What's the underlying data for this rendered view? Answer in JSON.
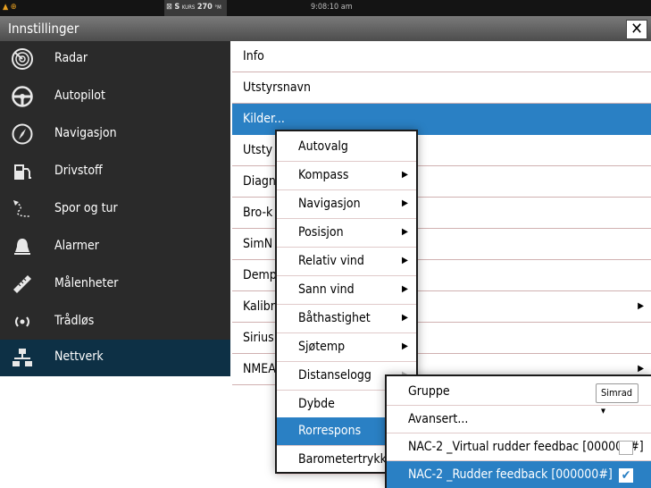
{
  "status_bar": {
    "kurs_prefix": "S",
    "kurs_label": "KURS",
    "kurs_value": "270",
    "kurs_unit": "°M",
    "time": "9:08:10 am"
  },
  "titlebar": {
    "title": "Innstillinger",
    "close_symbol": "✕"
  },
  "sidebar": {
    "items": [
      {
        "label": "Radar",
        "icon": "radar-icon"
      },
      {
        "label": "Autopilot",
        "icon": "steering-wheel-icon"
      },
      {
        "label": "Navigasjon",
        "icon": "compass-icon"
      },
      {
        "label": "Drivstoff",
        "icon": "fuel-pump-icon"
      },
      {
        "label": "Spor og tur",
        "icon": "track-icon"
      },
      {
        "label": "Alarmer",
        "icon": "bell-icon"
      },
      {
        "label": "Målenheter",
        "icon": "ruler-icon"
      },
      {
        "label": "Trådløs",
        "icon": "wireless-icon"
      },
      {
        "label": "Nettverk",
        "icon": "network-icon"
      }
    ],
    "selected_index": 8
  },
  "content": {
    "rows": [
      {
        "label": "Info"
      },
      {
        "label": "Utstyrsnavn"
      },
      {
        "label": "Kilder..."
      },
      {
        "label": "Utsty"
      },
      {
        "label": "Diagn"
      },
      {
        "label": "Bro-k"
      },
      {
        "label": "SimN"
      },
      {
        "label": "Demp"
      },
      {
        "label": "Kalibr"
      },
      {
        "label": "Sirius"
      },
      {
        "label": "NMEA"
      }
    ],
    "selected_index": 2
  },
  "menu": {
    "items": [
      {
        "label": "Autovalg"
      },
      {
        "label": "Kompass"
      },
      {
        "label": "Navigasjon"
      },
      {
        "label": "Posisjon"
      },
      {
        "label": "Relativ vind"
      },
      {
        "label": "Sann vind"
      },
      {
        "label": "Båthastighet"
      },
      {
        "label": "Sjøtemp"
      },
      {
        "label": "Distanselogg"
      },
      {
        "label": "Dybde"
      },
      {
        "label": "Rorrespons"
      },
      {
        "label": "Barometertrykk"
      }
    ],
    "selected_index": 10
  },
  "submenu": {
    "gruppe_label": "Gruppe",
    "gruppe_value": "Simrad",
    "avansert_label": "Avansert...",
    "devices": [
      {
        "label": "NAC-2 _Virtual rudder feedbac [000000#]",
        "checked": false
      },
      {
        "label": "NAC-2 _Rudder feedback [000000#]",
        "checked": true
      }
    ]
  },
  "colors": {
    "accent": "#2a80c4",
    "sidebar_bg": "#2a2a2a",
    "sidebar_selected": "#0d3045"
  }
}
